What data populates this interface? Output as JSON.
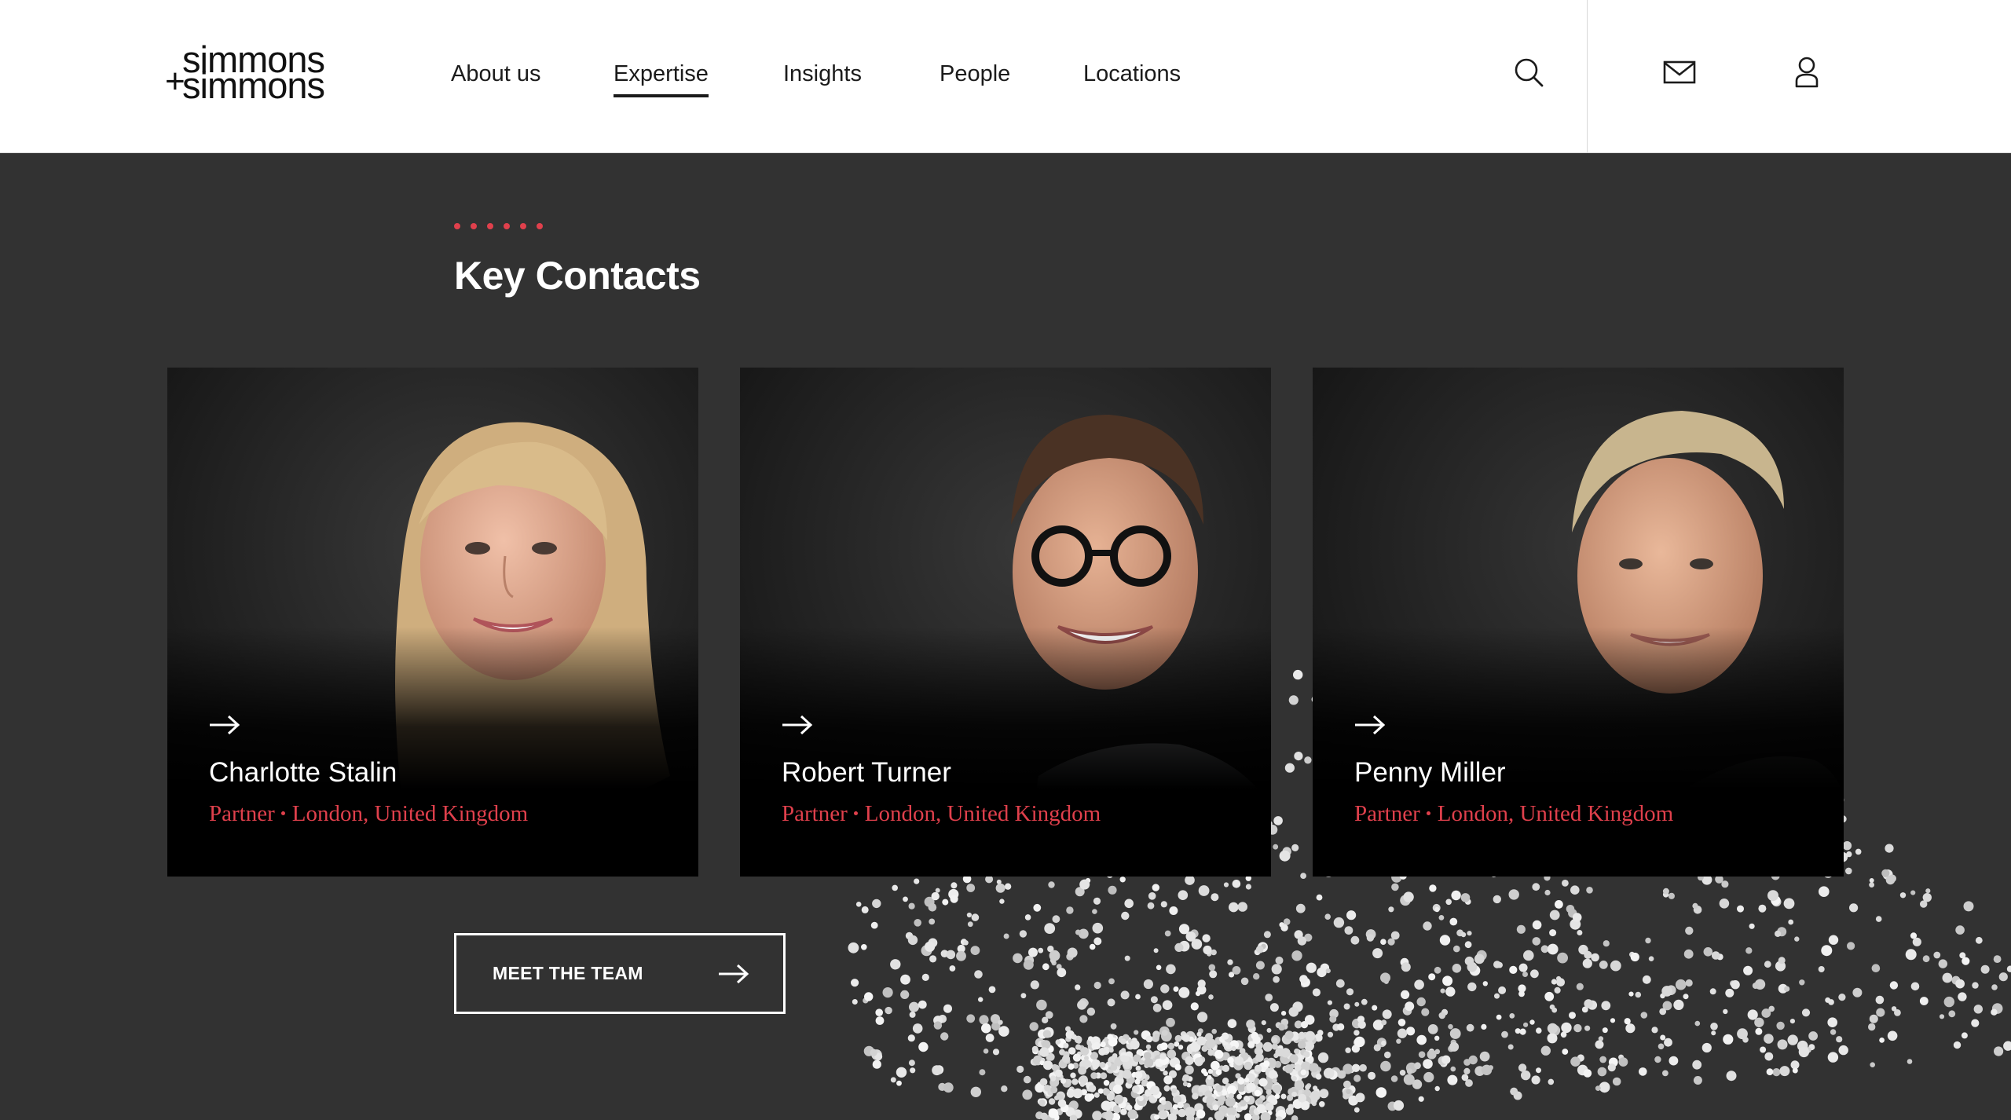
{
  "brand": {
    "logo_line1": "simmons",
    "logo_plus": "+",
    "logo_line2": "simmons"
  },
  "nav": {
    "items": [
      {
        "label": "About us",
        "active": false
      },
      {
        "label": "Expertise",
        "active": true
      },
      {
        "label": "Insights",
        "active": false
      },
      {
        "label": "People",
        "active": false
      },
      {
        "label": "Locations",
        "active": false
      }
    ]
  },
  "header_icons": [
    "search-icon",
    "mail-icon",
    "user-icon"
  ],
  "key_contacts": {
    "title": "Key Contacts",
    "contacts": [
      {
        "name": "Charlotte Stalin",
        "role": "Partner",
        "location": "London, United Kingdom"
      },
      {
        "name": "Robert Turner",
        "role": "Partner",
        "location": "London, United Kingdom"
      },
      {
        "name": "Penny Miller",
        "role": "Partner",
        "location": "London, United Kingdom"
      }
    ],
    "cta_label": "MEET THE TEAM"
  },
  "colors": {
    "accent": "#e0404c",
    "section_bg": "#323232",
    "header_bg": "#ffffff",
    "card_bg": "#000000"
  }
}
